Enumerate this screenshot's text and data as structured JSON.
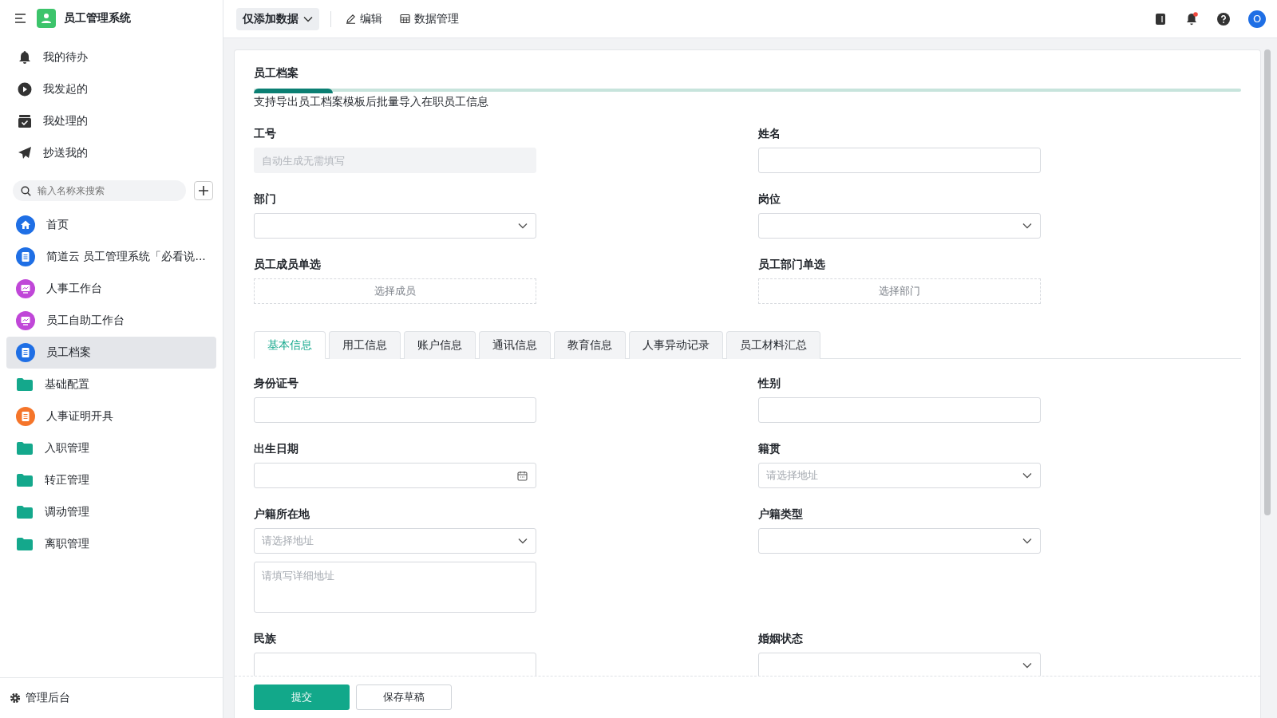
{
  "app": {
    "title": "员工管理系统"
  },
  "quick_menu": [
    {
      "label": "我的待办",
      "kind": "bell"
    },
    {
      "label": "我发起的",
      "kind": "play"
    },
    {
      "label": "我处理的",
      "kind": "check"
    },
    {
      "label": "抄送我的",
      "kind": "send"
    }
  ],
  "search": {
    "placeholder": "输入名称来搜索"
  },
  "nav": [
    {
      "label": "首页",
      "kind": "home",
      "color": "#1f6fe5",
      "selected": false
    },
    {
      "label": "简道云 员工管理系统「必看说...",
      "kind": "form",
      "color": "#1f6fe5",
      "selected": false
    },
    {
      "label": "人事工作台",
      "kind": "dash",
      "color": "#c047d8",
      "selected": false
    },
    {
      "label": "员工自助工作台",
      "kind": "dash",
      "color": "#c047d8",
      "selected": false
    },
    {
      "label": "员工档案",
      "kind": "form",
      "color": "#1f6fe5",
      "selected": true
    },
    {
      "label": "基础配置",
      "kind": "folder",
      "color": "#14a88c",
      "selected": false
    },
    {
      "label": "人事证明开具",
      "kind": "form",
      "color": "#f5752a",
      "selected": false
    },
    {
      "label": "入职管理",
      "kind": "folder",
      "color": "#14a88c",
      "selected": false
    },
    {
      "label": "转正管理",
      "kind": "folder",
      "color": "#14a88c",
      "selected": false
    },
    {
      "label": "调动管理",
      "kind": "folder",
      "color": "#14a88c",
      "selected": false
    },
    {
      "label": "离职管理",
      "kind": "folder",
      "color": "#14a88c",
      "selected": false
    }
  ],
  "admin": {
    "label": "管理后台"
  },
  "toolbar": {
    "mode": "仅添加数据",
    "actions": [
      {
        "label": "编辑",
        "kind": "edit"
      },
      {
        "label": "数据管理",
        "kind": "grid"
      }
    ]
  },
  "header": {
    "unread": true,
    "avatar": "O"
  },
  "form": {
    "title": "员工档案",
    "level": 0.08,
    "description": "支持导出员工档案模板后批量导入在职员工信息",
    "fields": [
      {
        "label": "工号",
        "kind": "disabled",
        "placeholder": "自动生成无需填写"
      },
      {
        "label": "姓名",
        "kind": "text"
      },
      {
        "label": "部门",
        "kind": "select"
      },
      {
        "label": "岗位",
        "kind": "select"
      },
      {
        "label": "员工成员单选",
        "kind": "picker",
        "button": "选择成员"
      },
      {
        "label": "员工部门单选",
        "kind": "picker",
        "button": "选择部门"
      }
    ],
    "tabs": [
      {
        "label": "基本信息",
        "selected": true
      },
      {
        "label": "用工信息",
        "selected": false
      },
      {
        "label": "账户信息",
        "selected": false
      },
      {
        "label": "通讯信息",
        "selected": false
      },
      {
        "label": "教育信息",
        "selected": false
      },
      {
        "label": "人事异动记录",
        "selected": false
      },
      {
        "label": "员工材料汇总",
        "selected": false
      }
    ],
    "tab_fields": [
      {
        "label": "身份证号",
        "kind": "text"
      },
      {
        "label": "性别",
        "kind": "text"
      },
      {
        "label": "出生日期",
        "kind": "date"
      },
      {
        "label": "籍贯",
        "kind": "select",
        "placeholder": "请选择地址"
      },
      {
        "label": "户籍所在地",
        "kind": "address",
        "placeholder": "请选择地址",
        "detail_placeholder": "请填写详细地址"
      },
      {
        "label": "户籍类型",
        "kind": "select"
      },
      {
        "label": "民族",
        "kind": "text"
      },
      {
        "label": "婚姻状态",
        "kind": "select"
      }
    ],
    "buttons": {
      "submit": "提交",
      "draft": "保存草稿"
    }
  }
}
